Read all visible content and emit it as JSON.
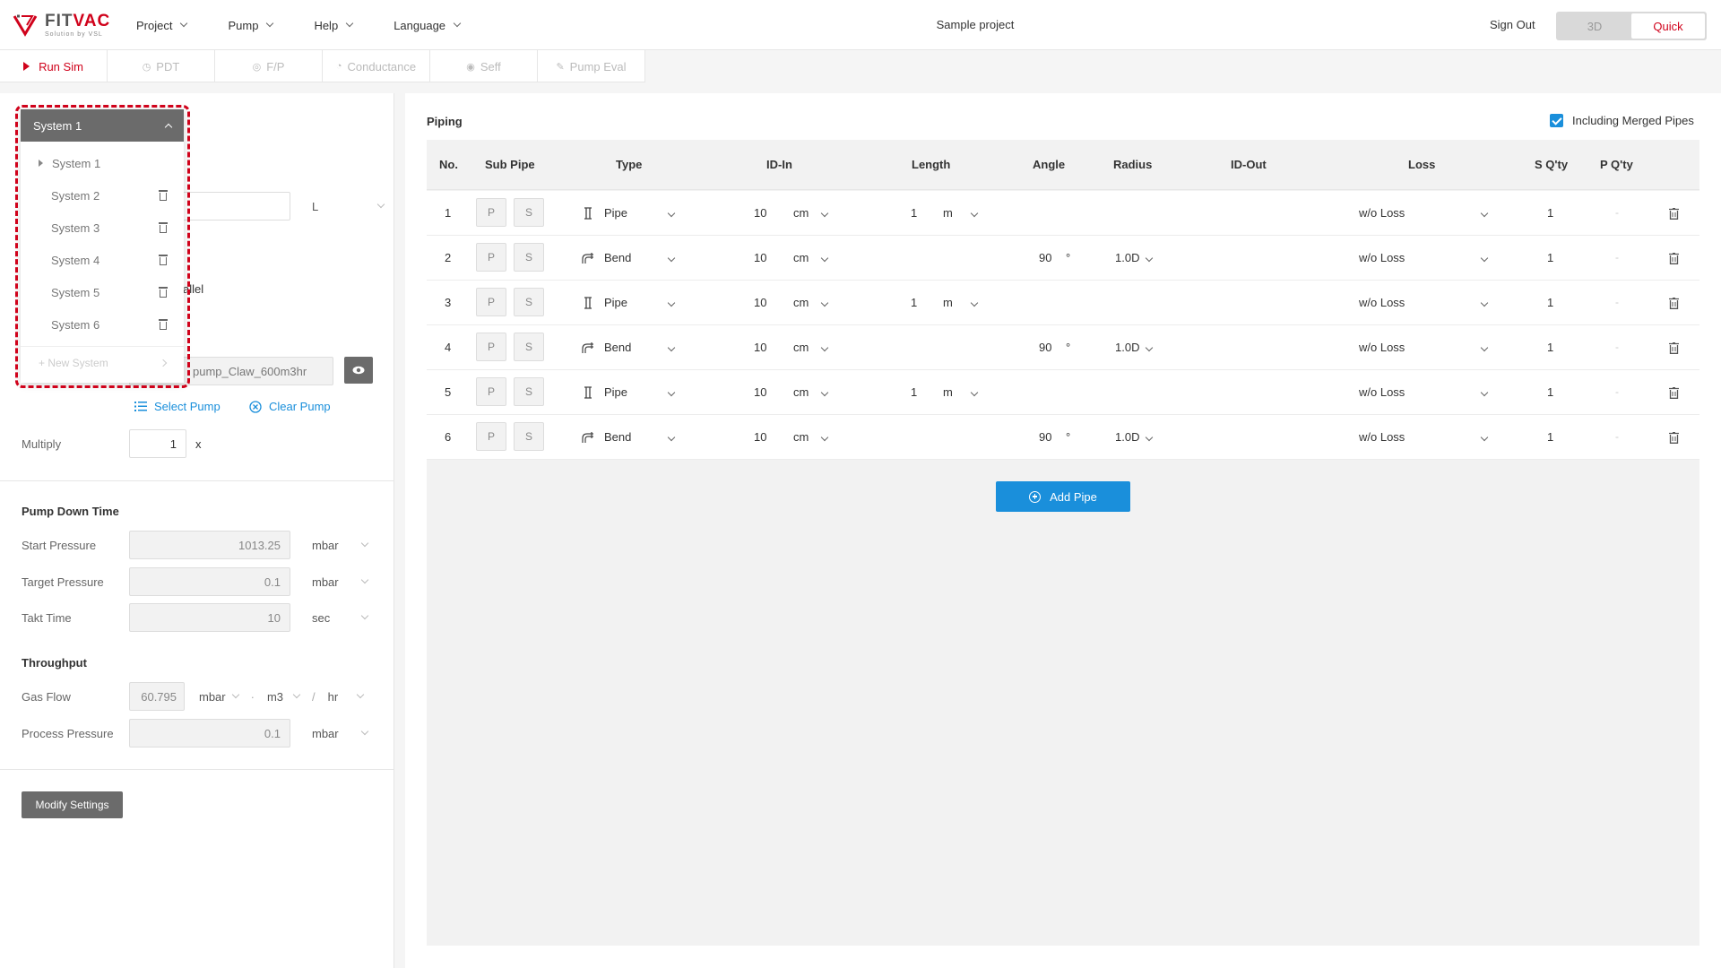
{
  "header": {
    "logo_word_a": "FIT",
    "logo_word_b": "VAC",
    "logo_sub": "Solution by VSL",
    "menu": [
      "Project",
      "Pump",
      "Help",
      "Language"
    ],
    "project_name": "Sample project",
    "sign_out": "Sign Out",
    "modes": [
      "3D",
      "Quick"
    ]
  },
  "toolbar": {
    "run_sim": "Run Sim",
    "pdt": "PDT",
    "fp": "F/P",
    "conductance": "Conductance",
    "seff": "Seff",
    "pump_eval": "Pump Eval"
  },
  "systems": {
    "selected": "System 1",
    "items": [
      "System 1",
      "System 2",
      "System 3",
      "System 4",
      "System 5",
      "System 6"
    ],
    "new_system": "+ New System"
  },
  "left": {
    "volume_unit": "L",
    "parallel_fragment": "allel",
    "pump_name": "pump_Claw_600m3hr",
    "select_pump": "Select Pump",
    "clear_pump": "Clear Pump",
    "multiply_label": "Multiply",
    "multiply_value": "1",
    "multiply_suffix": "x",
    "pdt_title": "Pump Down Time",
    "start_pressure_label": "Start Pressure",
    "start_pressure_value": "1013.25",
    "start_pressure_unit": "mbar",
    "target_pressure_label": "Target Pressure",
    "target_pressure_value": "0.1",
    "target_pressure_unit": "mbar",
    "takt_label": "Takt Time",
    "takt_value": "10",
    "takt_unit": "sec",
    "throughput_title": "Throughput",
    "gas_flow_label": "Gas Flow",
    "gas_flow_value": "60.795",
    "gas_flow_unit1": "mbar",
    "gas_flow_sep1": "·",
    "gas_flow_unit2": "m3",
    "gas_flow_sep2": "/",
    "gas_flow_unit3": "hr",
    "process_pressure_label": "Process Pressure",
    "process_pressure_value": "0.1",
    "process_pressure_unit": "mbar",
    "modify_settings": "Modify Settings"
  },
  "piping": {
    "title": "Piping",
    "merged_label": "Including Merged Pipes",
    "columns": [
      "No.",
      "Sub Pipe",
      "Type",
      "ID-In",
      "Length",
      "Angle",
      "Radius",
      "ID-Out",
      "Loss",
      "S Q'ty",
      "P Q'ty"
    ],
    "sub_p": "P",
    "sub_s": "S",
    "dash": "-",
    "rows": [
      {
        "no": "1",
        "type": "Pipe",
        "id_in": "10",
        "id_unit": "cm",
        "length": "1",
        "length_unit": "m",
        "angle": "",
        "angle_unit": "",
        "radius": "",
        "loss": "w/o Loss",
        "s_qty": "1"
      },
      {
        "no": "2",
        "type": "Bend",
        "id_in": "10",
        "id_unit": "cm",
        "length": "",
        "length_unit": "",
        "angle": "90",
        "angle_unit": "°",
        "radius": "1.0D",
        "loss": "w/o Loss",
        "s_qty": "1"
      },
      {
        "no": "3",
        "type": "Pipe",
        "id_in": "10",
        "id_unit": "cm",
        "length": "1",
        "length_unit": "m",
        "angle": "",
        "angle_unit": "",
        "radius": "",
        "loss": "w/o Loss",
        "s_qty": "1"
      },
      {
        "no": "4",
        "type": "Bend",
        "id_in": "10",
        "id_unit": "cm",
        "length": "",
        "length_unit": "",
        "angle": "90",
        "angle_unit": "°",
        "radius": "1.0D",
        "loss": "w/o Loss",
        "s_qty": "1"
      },
      {
        "no": "5",
        "type": "Pipe",
        "id_in": "10",
        "id_unit": "cm",
        "length": "1",
        "length_unit": "m",
        "angle": "",
        "angle_unit": "",
        "radius": "",
        "loss": "w/o Loss",
        "s_qty": "1"
      },
      {
        "no": "6",
        "type": "Bend",
        "id_in": "10",
        "id_unit": "cm",
        "length": "",
        "length_unit": "",
        "angle": "90",
        "angle_unit": "°",
        "radius": "1.0D",
        "loss": "w/o Loss",
        "s_qty": "1"
      }
    ],
    "add_pipe": "Add Pipe"
  },
  "colors": {
    "accent": "#d0021b",
    "primary": "#1a8fdb",
    "dark_button": "#6b6b6b"
  }
}
